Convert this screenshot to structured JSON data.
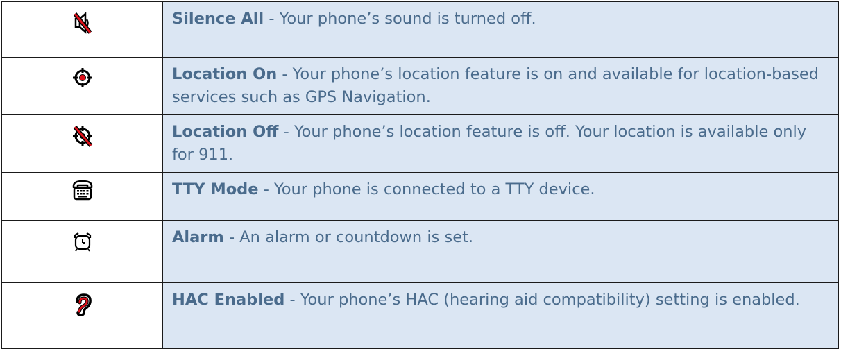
{
  "rows": [
    {
      "icon": "silence-all-icon",
      "term": "Silence All",
      "description": " - Your phone’s sound is turned off."
    },
    {
      "icon": "location-on-icon",
      "term": "Location On",
      "description": " - Your phone’s location feature is on and available for location-based services such as GPS Navigation."
    },
    {
      "icon": "location-off-icon",
      "term": "Location Off",
      "description": " - Your phone’s location feature is off. Your location is available only for 911."
    },
    {
      "icon": "tty-mode-icon",
      "term": "TTY Mode",
      "description": " - Your phone is connected to a TTY device."
    },
    {
      "icon": "alarm-clock-icon",
      "term": "Alarm",
      "description": " - An alarm or countdown is set."
    },
    {
      "icon": "hac-enabled-icon",
      "term": "HAC Enabled",
      "description": " - Your phone’s HAC (hearing aid compatibility) setting is enabled."
    }
  ],
  "colors": {
    "text": "#4a6b8c",
    "cell_background": "#dbe6f3",
    "border": "#1a1a1a",
    "accent_red": "#e0101a"
  }
}
